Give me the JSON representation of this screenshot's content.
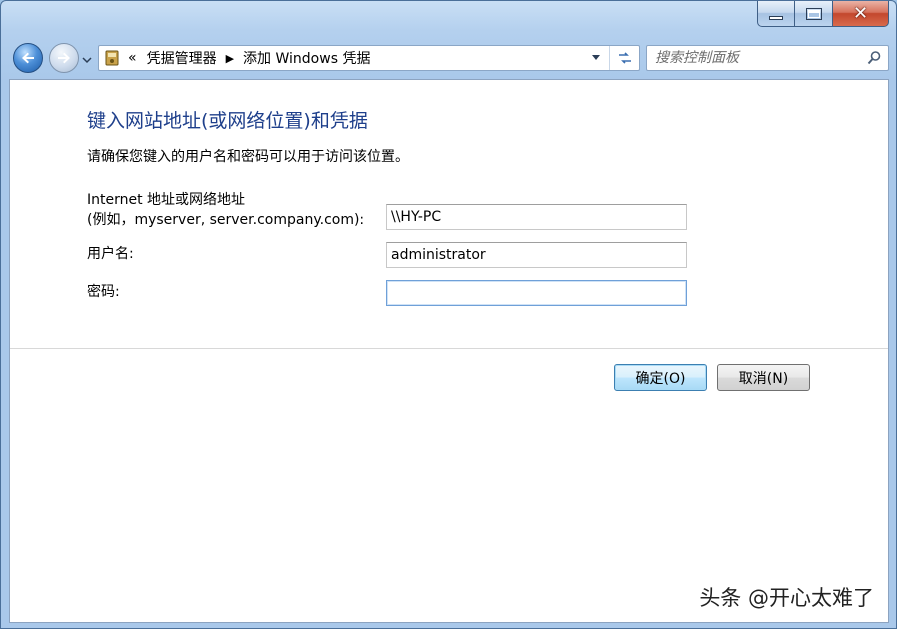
{
  "titlebar": {
    "minimize_icon": "minimize-icon",
    "maximize_icon": "maximize-icon",
    "close_icon": "close-icon"
  },
  "navigation": {
    "back_icon": "back-arrow-icon",
    "forward_icon": "forward-arrow-icon",
    "history_icon": "chevron-down-icon"
  },
  "address": {
    "overflow": "«",
    "breadcrumbs": [
      "凭据管理器",
      "添加 Windows 凭据"
    ],
    "separator": "▶"
  },
  "search": {
    "placeholder": "搜索控制面板"
  },
  "form": {
    "heading": "键入网站地址(或网络位置)和凭据",
    "description": "请确保您键入的用户名和密码可以用于访问该位置。",
    "address_label_line1": "Internet 地址或网络地址",
    "address_label_line2": "(例如，myserver, server.company.com):",
    "address_value": "\\\\HY-PC",
    "username_label": "用户名:",
    "username_value": "administrator",
    "password_label": "密码:",
    "password_value": ""
  },
  "buttons": {
    "ok": "确定(O)",
    "cancel": "取消(N)"
  },
  "watermark": "头条 @开心太难了",
  "colors": {
    "heading": "#1e3f8b",
    "chrome": "#a9c8ea"
  }
}
